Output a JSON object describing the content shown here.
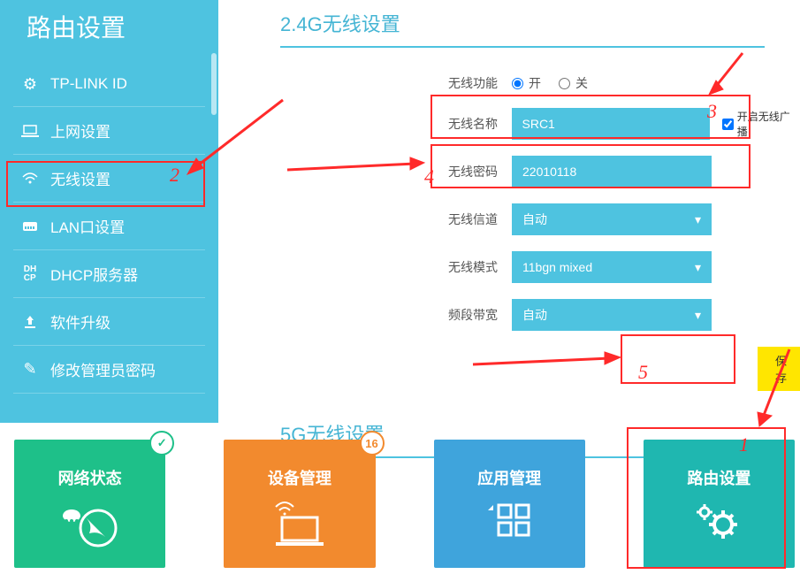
{
  "sidebar": {
    "title": "路由设置",
    "items": [
      {
        "icon": "gear",
        "label": "TP-LINK ID"
      },
      {
        "icon": "laptop",
        "label": "上网设置"
      },
      {
        "icon": "wifi",
        "label": "无线设置"
      },
      {
        "icon": "lan",
        "label": "LAN口设置"
      },
      {
        "icon": "dhcp",
        "label": "DHCP服务器"
      },
      {
        "icon": "upload",
        "label": "软件升级"
      },
      {
        "icon": "pencil",
        "label": "修改管理员密码"
      }
    ]
  },
  "wireless24": {
    "title": "2.4G无线设置",
    "func_label": "无线功能",
    "on": "开",
    "off": "关",
    "name_label": "无线名称",
    "name_value": "SRC1",
    "broadcast_label": "开启无线广播",
    "pwd_label": "无线密码",
    "pwd_value": "22010118",
    "channel_label": "无线信道",
    "channel_value": "自动",
    "mode_label": "无线模式",
    "mode_value": "11bgn mixed",
    "band_label": "频段带宽",
    "band_value": "自动",
    "save": "保存"
  },
  "wireless5": {
    "title": "5G无线设置"
  },
  "cards": {
    "network": "网络状态",
    "devices": "设备管理",
    "devices_count": "16",
    "apps": "应用管理",
    "router": "路由设置"
  },
  "annotations": {
    "n1": "1",
    "n2": "2",
    "n3": "3",
    "n4": "4",
    "n5": "5"
  }
}
